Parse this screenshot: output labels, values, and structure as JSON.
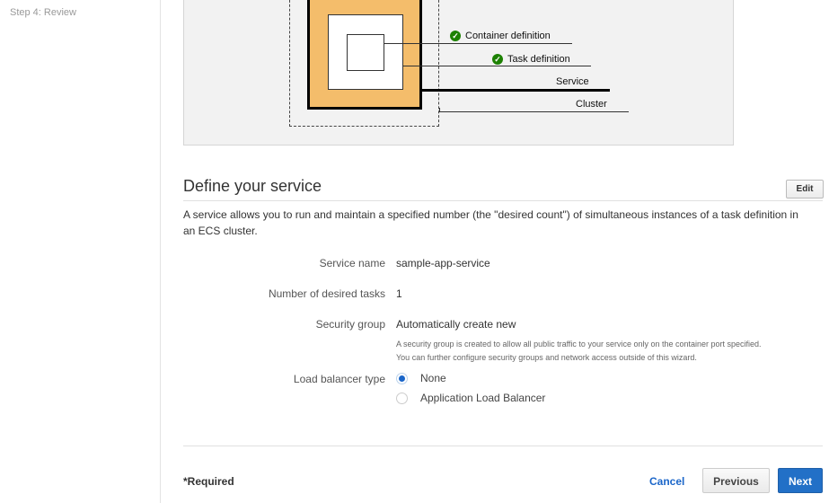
{
  "sidebar": {
    "steps": [
      "Step 4: Review"
    ]
  },
  "diagram": {
    "labels": {
      "container_definition": "Container definition",
      "task_definition": "Task definition",
      "service": "Service",
      "cluster": "Cluster"
    },
    "status": {
      "container_definition": "complete",
      "task_definition": "complete"
    },
    "colors": {
      "cluster_fill": "#f4bd6b",
      "check": "#1d8102"
    }
  },
  "section": {
    "title": "Define your service",
    "edit_label": "Edit",
    "description": "A service allows you to run and maintain a specified number (the \"desired count\") of simultaneous instances of a task definition in an ECS cluster."
  },
  "fields": {
    "service_name": {
      "label": "Service name",
      "value": "sample-app-service"
    },
    "desired_tasks": {
      "label": "Number of desired tasks",
      "value": "1"
    },
    "security_group": {
      "label": "Security group",
      "value": "Automatically create new",
      "help_line1": "A security group is created to allow all public traffic to your service only on the container port specified.",
      "help_line2": "You can further configure security groups and network access outside of this wizard."
    },
    "load_balancer": {
      "label": "Load balancer type",
      "options": [
        "None",
        "Application Load Balancer"
      ],
      "selected": "None"
    }
  },
  "footer": {
    "required": "*Required",
    "cancel": "Cancel",
    "previous": "Previous",
    "next": "Next",
    "accent": "#2270c7"
  }
}
